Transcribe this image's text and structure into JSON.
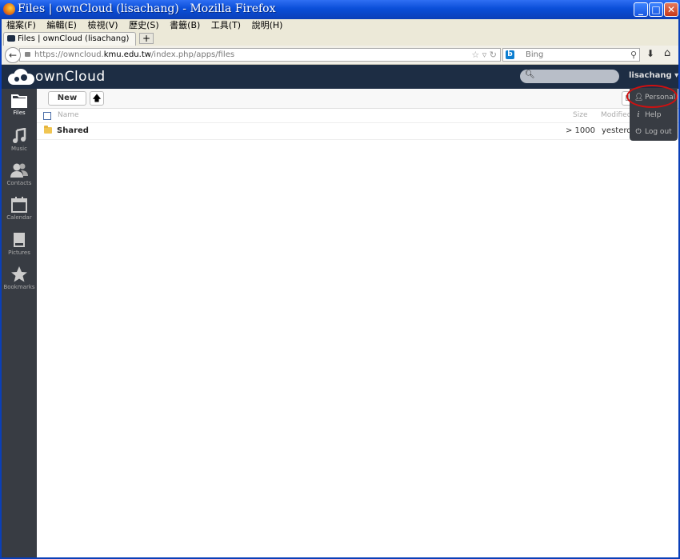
{
  "window": {
    "title": "Files | ownCloud (lisachang) - Mozilla Firefox",
    "minimize": "_",
    "maximize": "□",
    "close": "✕"
  },
  "menu": [
    "檔案(F)",
    "編輯(E)",
    "檢視(V)",
    "歷史(S)",
    "書籤(B)",
    "工具(T)",
    "說明(H)"
  ],
  "tab": {
    "label": "Files | ownCloud (lisachang)",
    "new_tab": "+"
  },
  "nav": {
    "url_prefix": "https://owncloud.",
    "url_domain": "kmu.edu.tw",
    "url_path": "/index.php/apps/files",
    "search_placeholder": "Bing"
  },
  "owncloud": {
    "logo_text": "ownCloud",
    "user": "lisachang ▾",
    "sidebar": [
      {
        "label": "Files",
        "icon": "folder-icon"
      },
      {
        "label": "Music",
        "icon": "music-icon"
      },
      {
        "label": "Contacts",
        "icon": "contacts-icon"
      },
      {
        "label": "Calendar",
        "icon": "calendar-icon"
      },
      {
        "label": "Pictures",
        "icon": "picture-icon"
      },
      {
        "label": "Bookmarks",
        "icon": "star-icon"
      }
    ],
    "toolbar": {
      "new_label": "New",
      "upload_glyph": "🡅"
    },
    "table": {
      "col_name": "Name",
      "col_size": "Size",
      "col_modified": "Modified",
      "rows": [
        {
          "name": "Shared",
          "size": "> 1000",
          "modified": "yesterday"
        }
      ]
    },
    "user_menu": [
      {
        "label": "Personal",
        "icon": "person-icon"
      },
      {
        "label": "Help",
        "icon": "info-icon"
      },
      {
        "label": "Log out",
        "icon": "power-icon"
      }
    ]
  }
}
